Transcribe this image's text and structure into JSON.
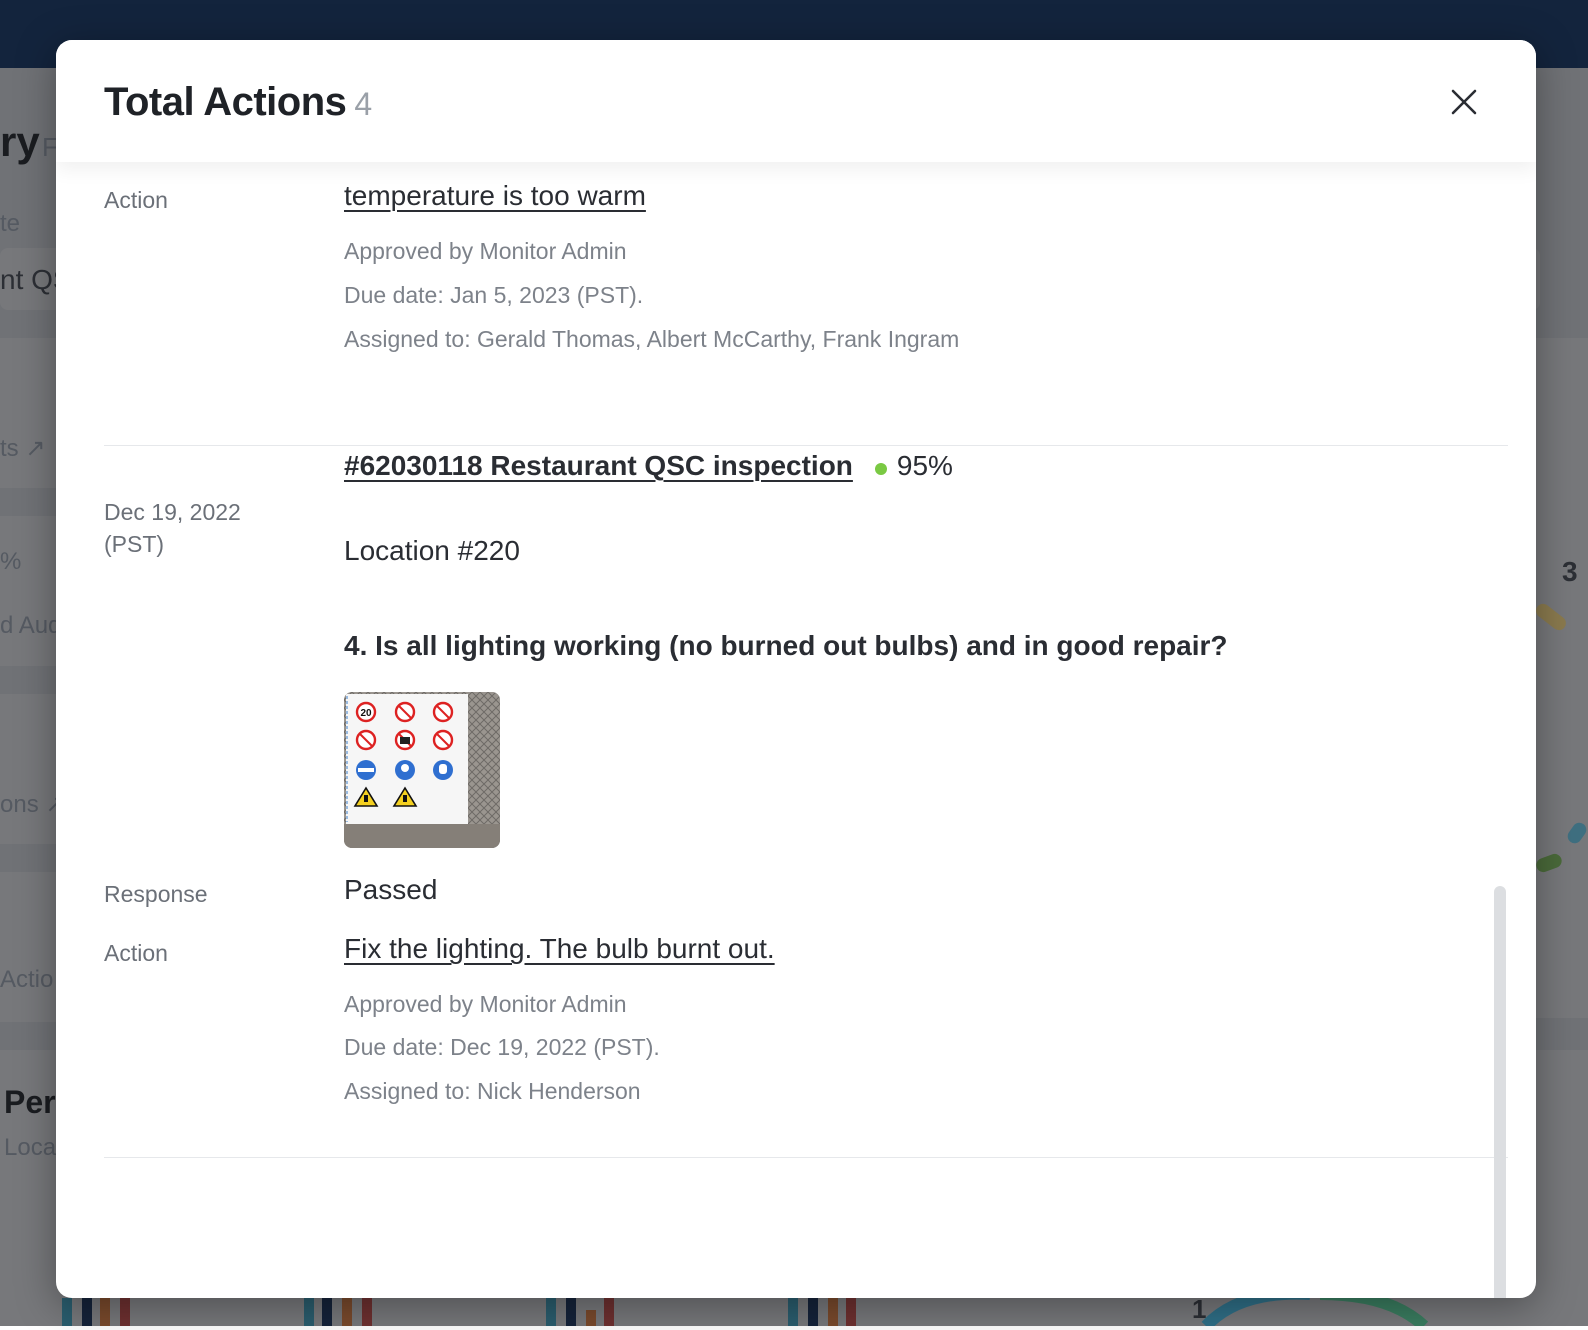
{
  "background": {
    "title_fragment": "ry",
    "title_fragment2": "F",
    "labels": [
      "te",
      "nt QS",
      "ts ↗",
      "%",
      "d Aud",
      "ons ↗",
      "Actio",
      "Per",
      "Loca"
    ],
    "gauge_value": "3",
    "gauge_value2": "1",
    "colors": {
      "topbar": "#13243d",
      "bar_teal": "#3aa3c4",
      "bar_navy": "#1d3558",
      "bar_orange": "#e07a3c",
      "bar_red": "#c84a3c",
      "arc_yellow": "#e8b84a",
      "arc_teal": "#3aa3c4",
      "arc_green": "#6bb04a"
    }
  },
  "modal": {
    "title": "Total Actions",
    "count": "4",
    "close_icon": "close-icon",
    "entries": [
      {
        "action_label": "Action",
        "action_text": "temperature is too warm",
        "approved": "Approved by Monitor Admin",
        "due": "Due date: Jan 5, 2023 (PST).",
        "assigned": "Assigned to: Gerald Thomas, Albert McCarthy, Frank Ingram"
      },
      {
        "date_line1": "Dec 19, 2022",
        "date_line2": "(PST)",
        "inspection_title": "#62030118 Restaurant QSC inspection",
        "score": "95%",
        "score_color": "#7ac943",
        "location": "Location #220",
        "question": "4. Is all lighting working (no burned out bulbs) and in good repair?",
        "photo_icon": "safety-signs-photo",
        "response_label": "Response",
        "response_value": "Passed",
        "action_label": "Action",
        "action_text": "Fix the lighting. The bulb burnt out.",
        "approved": "Approved by Monitor Admin",
        "due": "Due date: Dec 19, 2022 (PST).",
        "assigned": "Assigned to: Nick Henderson"
      }
    ]
  }
}
